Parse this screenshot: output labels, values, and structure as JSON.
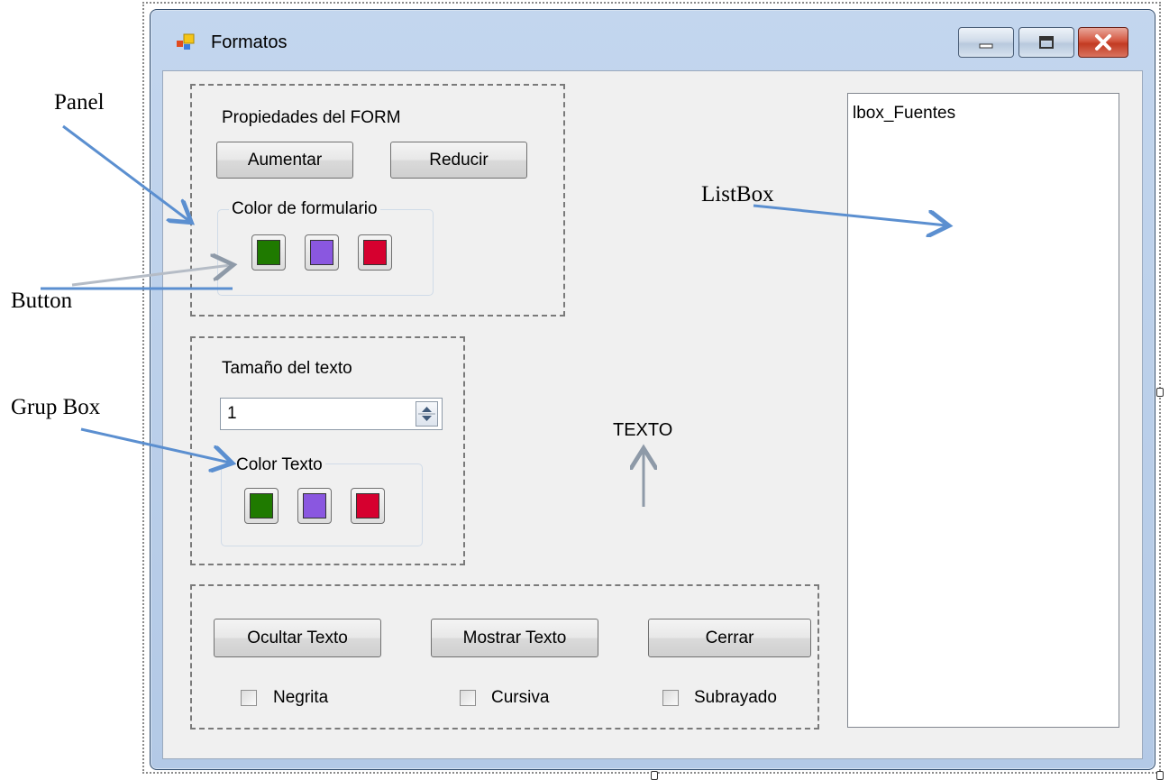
{
  "window": {
    "title": "Formatos"
  },
  "panel_form": {
    "title": "Propiedades del FORM",
    "increase_label": "Aumentar",
    "reduce_label": "Reducir",
    "color_group": {
      "label": "Color de formulario",
      "swatches": [
        "#1f7a00",
        "#8a57e0",
        "#d6002f"
      ]
    }
  },
  "text_group": {
    "size_label": "Tamaño del texto",
    "size_value": "1",
    "color_group": {
      "label": "Color Texto",
      "swatches": [
        "#1f7a00",
        "#8a57e0",
        "#d6002f"
      ]
    }
  },
  "preview_text": "TEXTO",
  "bottom_panel": {
    "hide_label": "Ocultar Texto",
    "show_label": "Mostrar Texto",
    "close_label": "Cerrar",
    "bold_label": "Negrita",
    "italic_label": "Cursiva",
    "underline_label": "Subrayado"
  },
  "listbox": {
    "name": "lbox_Fuentes"
  },
  "annotations": {
    "panel": "Panel",
    "button": "Button",
    "groupbox": "Grup Box",
    "listbox": "ListBox"
  },
  "colors": {
    "arrow": "#5b8fd0",
    "window_frame": "#b3c9e6",
    "client_bg": "#f0f0f0"
  }
}
